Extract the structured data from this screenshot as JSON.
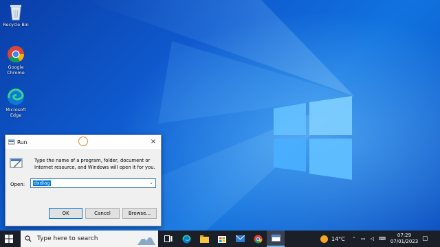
{
  "desktop": {
    "icons": [
      {
        "label": "Recycle Bin",
        "icon": "recycle-bin-icon"
      },
      {
        "label": "Google Chrome",
        "icon": "chrome-icon"
      },
      {
        "label": "Microsoft Edge",
        "icon": "edge-icon"
      }
    ],
    "accent": "#0f5bd0"
  },
  "run_dialog": {
    "title": "Run",
    "description": "Type the name of a program, folder, document or Internet resource, and Windows will open it for you.",
    "open_label": "Open:",
    "open_value": "dxdiag",
    "ok_label": "OK",
    "cancel_label": "Cancel",
    "browse_label": "Browse...",
    "close_glyph": "×"
  },
  "taskbar": {
    "search_placeholder": "Type here to search",
    "weather_temp": "14°C",
    "time": "07:29",
    "date": "07/01/2023",
    "pinned": [
      "task-view-icon",
      "edge-icon",
      "file-explorer-icon",
      "store-icon",
      "mail-icon",
      "chrome-icon",
      "run-icon"
    ]
  }
}
